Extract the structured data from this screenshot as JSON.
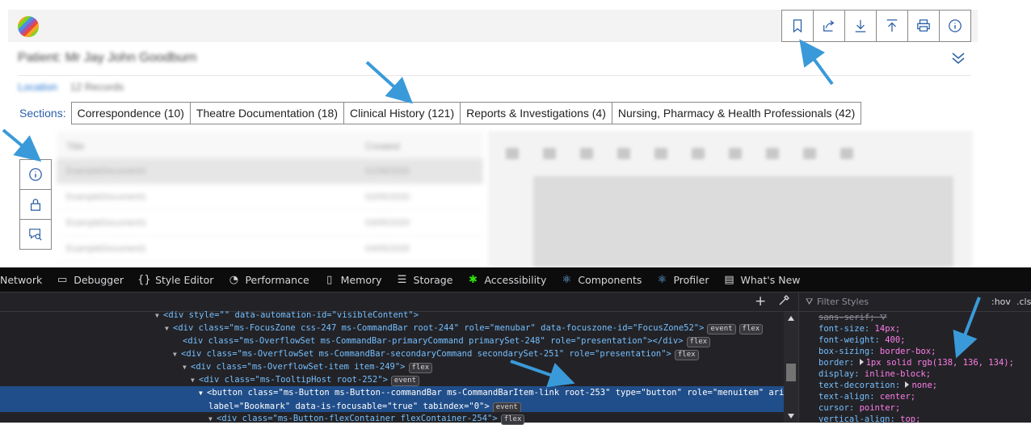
{
  "header": {
    "patient_text": "Patient: Mr Jay John Goodburn",
    "location_label": "Location",
    "location_value": "12 Records",
    "commands": [
      {
        "icon": "bookmark-icon",
        "label": "Bookmark"
      },
      {
        "icon": "share-icon",
        "label": "Share"
      },
      {
        "icon": "download-icon",
        "label": "Download"
      },
      {
        "icon": "upload-icon",
        "label": "Upload"
      },
      {
        "icon": "print-icon",
        "label": "Print"
      },
      {
        "icon": "info-icon",
        "label": "Info"
      }
    ]
  },
  "sections": {
    "label": "Sections:",
    "tabs": [
      "Correspondence (10)",
      "Theatre Documentation (18)",
      "Clinical History (121)",
      "Reports & Investigations (4)",
      "Nursing, Pharmacy & Health Professionals (42)"
    ]
  },
  "side_buttons": [
    {
      "icon": "info-icon"
    },
    {
      "icon": "lock-icon"
    },
    {
      "icon": "search-comment-icon"
    }
  ],
  "document_list": {
    "headers": [
      "Title",
      "Created"
    ],
    "rows": [
      [
        "ExampleDocument1",
        "01/06/2020"
      ],
      [
        "ExampleDocument1",
        "02/05/2020"
      ],
      [
        "ExampleDocument1",
        "03/05/2020"
      ],
      [
        "ExampleDocument1",
        "04/05/2020"
      ]
    ]
  },
  "devtools": {
    "tabs": [
      {
        "icon": "network-icon",
        "label": "Network"
      },
      {
        "icon": "debugger-icon",
        "label": "Debugger"
      },
      {
        "icon": "style-editor-icon",
        "label": "Style Editor"
      },
      {
        "icon": "performance-icon",
        "label": "Performance"
      },
      {
        "icon": "memory-icon",
        "label": "Memory"
      },
      {
        "icon": "storage-icon",
        "label": "Storage"
      },
      {
        "icon": "accessibility-icon",
        "label": "Accessibility"
      },
      {
        "icon": "react-icon",
        "label": "Components"
      },
      {
        "icon": "react-icon",
        "label": "Profiler"
      },
      {
        "icon": "whats-new-icon",
        "label": "What's New"
      }
    ],
    "filter_placeholder": "Filter Styles",
    "hov": ":hov",
    "cls": ".cls",
    "code_lines": [
      "<div style=\"\" data-automation-id=\"visibleContent\">",
      "<div class=\"ms-FocusZone css-247 ms-CommandBar root-244\" role=\"menubar\" data-focuszone-id=\"FocusZone52\">",
      "<div class=\"ms-OverflowSet ms-CommandBar-primaryCommand primarySet-248\" role=\"presentation\"></div>",
      "<div class=\"ms-OverflowSet ms-CommandBar-secondaryCommand secondarySet-251\" role=\"presentation\">",
      "<div class=\"ms-OverflowSet-item item-249\">",
      "<div class=\"ms-TooltipHost root-252\">",
      "<button class=\"ms-Button ms-Button--commandBar ms-CommandBarItem-link root-253\" type=\"button\" role=\"menuitem\" aria-",
      "label=\"Bookmark\" data-is-focusable=\"true\" tabindex=\"0\">",
      "<div class=\"ms-Button-flexContainer flexContainer-254\">"
    ],
    "badges": {
      "event": "event",
      "flex": "flex"
    },
    "css_decls": [
      {
        "prop": "sans-serif;",
        "value": "",
        "struck": true
      },
      {
        "prop": "font-size:",
        "value": "14px;"
      },
      {
        "prop": "font-weight:",
        "value": "400;"
      },
      {
        "prop": "box-sizing:",
        "value": "border-box;"
      },
      {
        "prop": "border:",
        "value": "1px solid rgb(138, 136, 134);"
      },
      {
        "prop": "display:",
        "value": "inline-block;"
      },
      {
        "prop": "text-decoration:",
        "value": "none;"
      },
      {
        "prop": "text-align:",
        "value": "center;"
      },
      {
        "prop": "cursor:",
        "value": "pointer;"
      },
      {
        "prop": "vertical-align:",
        "value": "top;"
      }
    ]
  },
  "colors": {
    "accent": "#2b5fa8",
    "annotation_arrow": "#3a9ad9",
    "border": "#8a8886",
    "devtools_bg": "#232327",
    "selection": "#204e8a"
  }
}
